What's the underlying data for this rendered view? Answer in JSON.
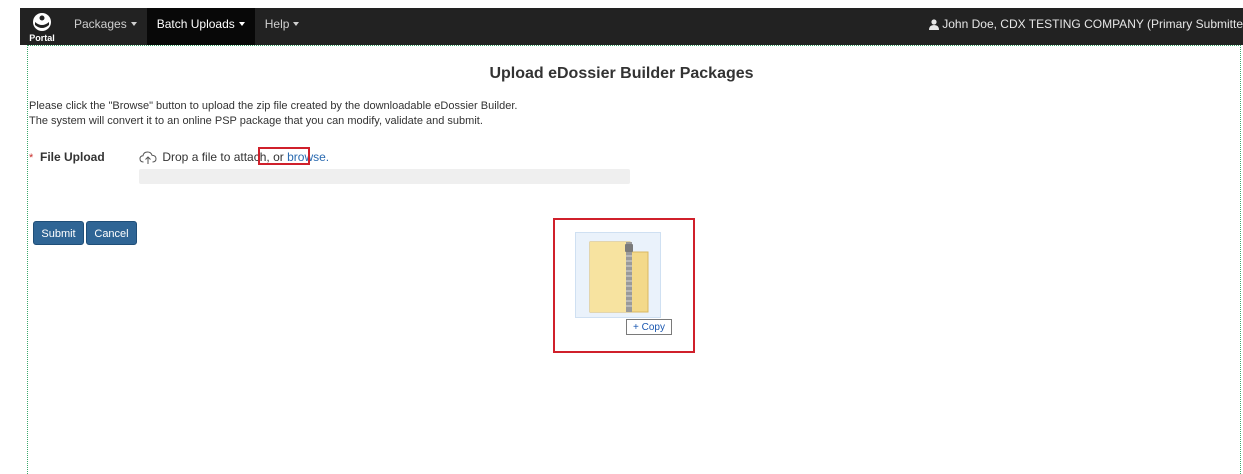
{
  "header": {
    "logo_text": "Portal",
    "nav": [
      {
        "label": "Packages"
      },
      {
        "label": "Batch Uploads"
      },
      {
        "label": "Help"
      }
    ],
    "user_text": "John Doe, CDX TESTING COMPANY (Primary Submitte"
  },
  "main": {
    "title": "Upload eDossier Builder Packages",
    "instructions": [
      "Please click the \"Browse\" button to upload the zip file created by the downloadable eDossier Builder.",
      "The system will convert it to an online PSP package that you can modify, validate and submit."
    ],
    "file_upload": {
      "required_marker": "*",
      "label": "File Upload",
      "drop_text": "Drop a file to attach,",
      "or_text": "or",
      "browse_text": "browse."
    },
    "buttons": {
      "submit": "Submit",
      "cancel": "Cancel"
    },
    "drag_overlay": {
      "copy_plus": "+",
      "copy_label": "Copy"
    }
  },
  "colors": {
    "navbar_bg": "#222222",
    "nav_active_bg": "#080808",
    "button_bg": "#2f6595",
    "highlight_red": "#d0202b",
    "link_blue": "#2a6ab0"
  },
  "icons": {
    "logo": "portal-logo-icon",
    "user": "user-icon",
    "upload": "cloud-upload-icon",
    "zip": "zip-folder-icon"
  }
}
